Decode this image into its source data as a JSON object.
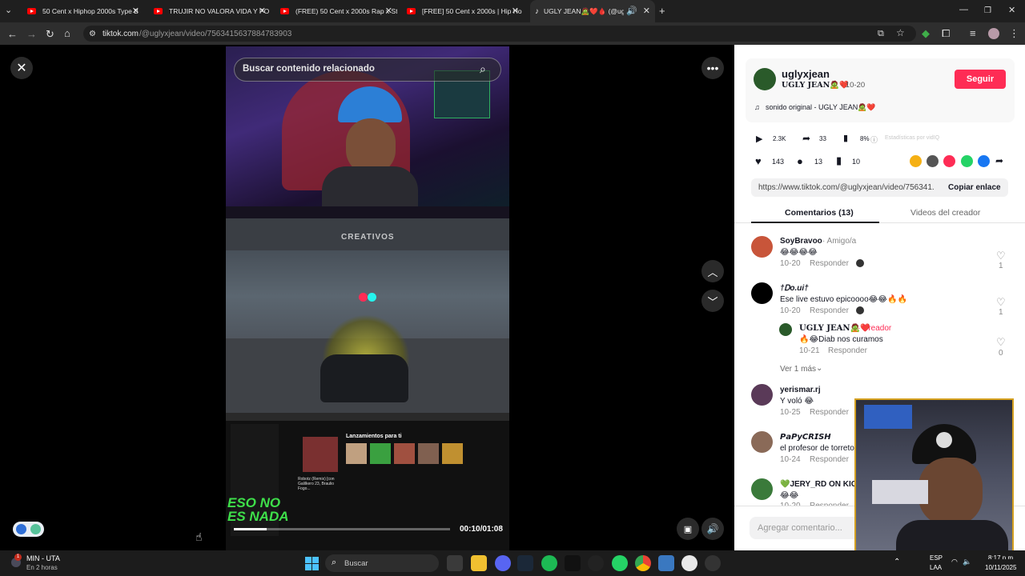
{
  "browser": {
    "tabs": [
      {
        "label": "50 Cent x Hiphop 2000s Type B"
      },
      {
        "label": "TRUJIR NO VALORA VIDA Y PO"
      },
      {
        "label": "(FREE) 50 Cent x 2000s Rap x St"
      },
      {
        "label": "[FREE] 50 Cent x 2000s | Hip Ho"
      },
      {
        "label": "UGLY JEAN🧟❤️🩸 (@ugly"
      }
    ],
    "url_domain": "tiktok.com",
    "url_path": "/@uglyxjean/video/7563415637884783903"
  },
  "video": {
    "search_placeholder": "Buscar contenido relacionado",
    "time": "00:10/01:08",
    "progress": 0.15,
    "overlay_text_1": "ESO NO",
    "overlay_text_2": "ES NADA",
    "player_title": "Lanzamientos para ti",
    "player_song": "Robotz (Remix) [con Galilkero 23, Braulio Fogo...",
    "game_watermark": "CREATIVOS"
  },
  "creator": {
    "username": "uglyxjean",
    "display": "UGLY JEAN🧟❤️",
    "date": "· 10-20",
    "follow": "Seguir",
    "sound": "sonido original - UGLY JEAN🧟❤️"
  },
  "stats": {
    "plays": "2.3K",
    "shares": "33",
    "pct": "8%",
    "stats_label": "Estadísticas por vidIQ",
    "likes": "143",
    "comments": "13",
    "saves": "10"
  },
  "share": {
    "link": "https://www.tiktok.com/@uglyxjean/video/756341...",
    "copy": "Copiar enlace",
    "colors": [
      "#f5b014",
      "#555555",
      "#fe2c55",
      "#25d366",
      "#1877f2"
    ]
  },
  "tabs": {
    "comments": "Comentarios (13)",
    "videos": "Videos del creador"
  },
  "comments": [
    {
      "user": "SoyBravoo",
      "badge": "· Amigo/a",
      "text": "😂😂😂😂",
      "date": "10-20",
      "reply": "Responder",
      "likes": "1"
    },
    {
      "user": "†Ꭰo.ui†",
      "text": "Ese live estuvo epicoooo😂😂🔥🔥",
      "date": "10-20",
      "reply": "Responder",
      "likes": "1"
    },
    {
      "user": "UGLY JEAN🧟❤️",
      "badge": "· Creador",
      "text": "🔥😂Diab nos curamos",
      "date": "10-21",
      "reply": "Responder",
      "likes": "0"
    },
    {
      "user": "yerismar.rj",
      "text": "Y voló 😂",
      "date": "10-25",
      "reply": "Responder"
    },
    {
      "user": "𝙋𝙖𝙋𝙮𝘾𝙍𝙄𝙎𝙃",
      "text": "el profesor de torreto",
      "date": "10-24",
      "reply": "Responder"
    },
    {
      "user": "💚JERY_RD ON KICK",
      "text": "😂😂",
      "date": "10-20",
      "reply": "Responder"
    }
  ],
  "see_more": "Ver 1 más",
  "add_comment_placeholder": "Agregar comentario...",
  "taskbar": {
    "weather_temp": "MIN - UTA",
    "weather_sub": "En 2 horas",
    "search": "Buscar",
    "lang_1": "ESP",
    "lang_2": "LAA",
    "time": "8:17 p.m.",
    "date": "10/11/2025"
  }
}
